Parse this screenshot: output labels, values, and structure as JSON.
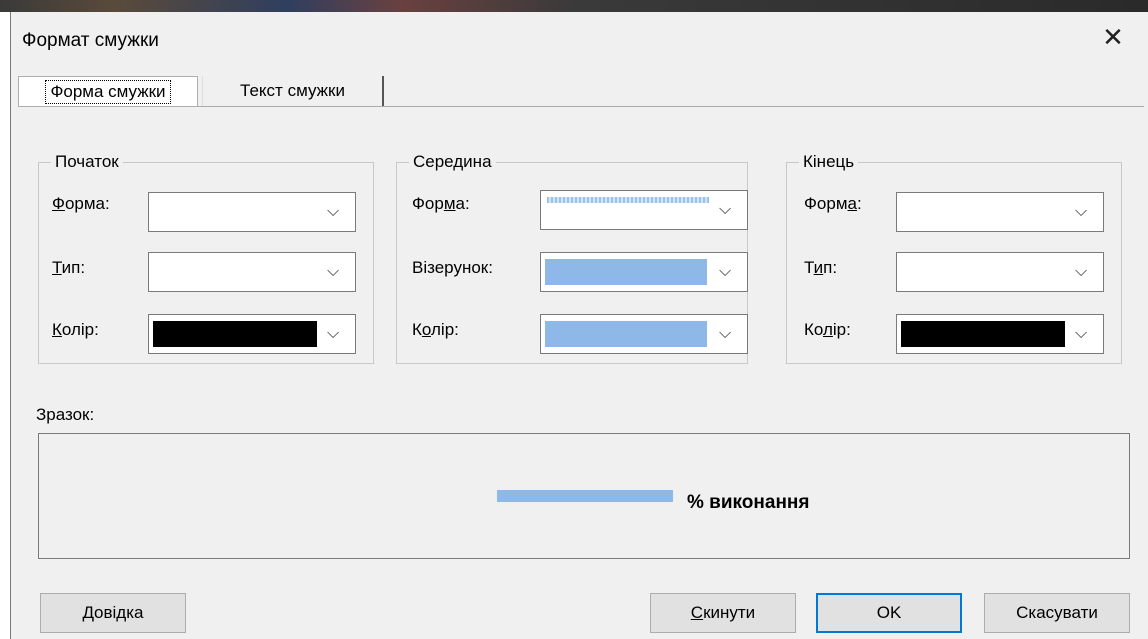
{
  "dialog": {
    "title": "Формат смужки",
    "close_icon": "close-icon"
  },
  "tabs": [
    {
      "label": "Форма смужки",
      "active": true
    },
    {
      "label": "Текст смужки",
      "active": false
    }
  ],
  "groups": {
    "start": {
      "legend": "Початок",
      "shape_label": {
        "pre": "",
        "u": "Ф",
        "post": "орма:"
      },
      "type_label": {
        "pre": "",
        "u": "Т",
        "post": "ип:"
      },
      "color_label": {
        "pre": "",
        "u": "К",
        "post": "олір:"
      },
      "color_value": "#000000"
    },
    "middle": {
      "legend": "Середина",
      "shape_label": {
        "pre": "Фор",
        "u": "м",
        "post": "а:"
      },
      "pattern_label": "Візерунок:",
      "color_label": {
        "pre": "К",
        "u": "о",
        "post": "лір:"
      },
      "color_value": "#8db8e8"
    },
    "end": {
      "legend": "Кінець",
      "shape_label": {
        "pre": "Форм",
        "u": "а",
        "post": ":"
      },
      "type_label": {
        "pre": "Т",
        "u": "и",
        "post": "п:"
      },
      "color_label": {
        "pre": "Ко",
        "u": "л",
        "post": "ір:"
      },
      "color_value": "#000000"
    }
  },
  "sample": {
    "label": "Зразок:",
    "text": "% виконання"
  },
  "buttons": {
    "help": {
      "u": "Д",
      "post": "овідка"
    },
    "reset": {
      "u": "С",
      "post": "кинути"
    },
    "ok": "OK",
    "cancel": "Скасувати"
  }
}
